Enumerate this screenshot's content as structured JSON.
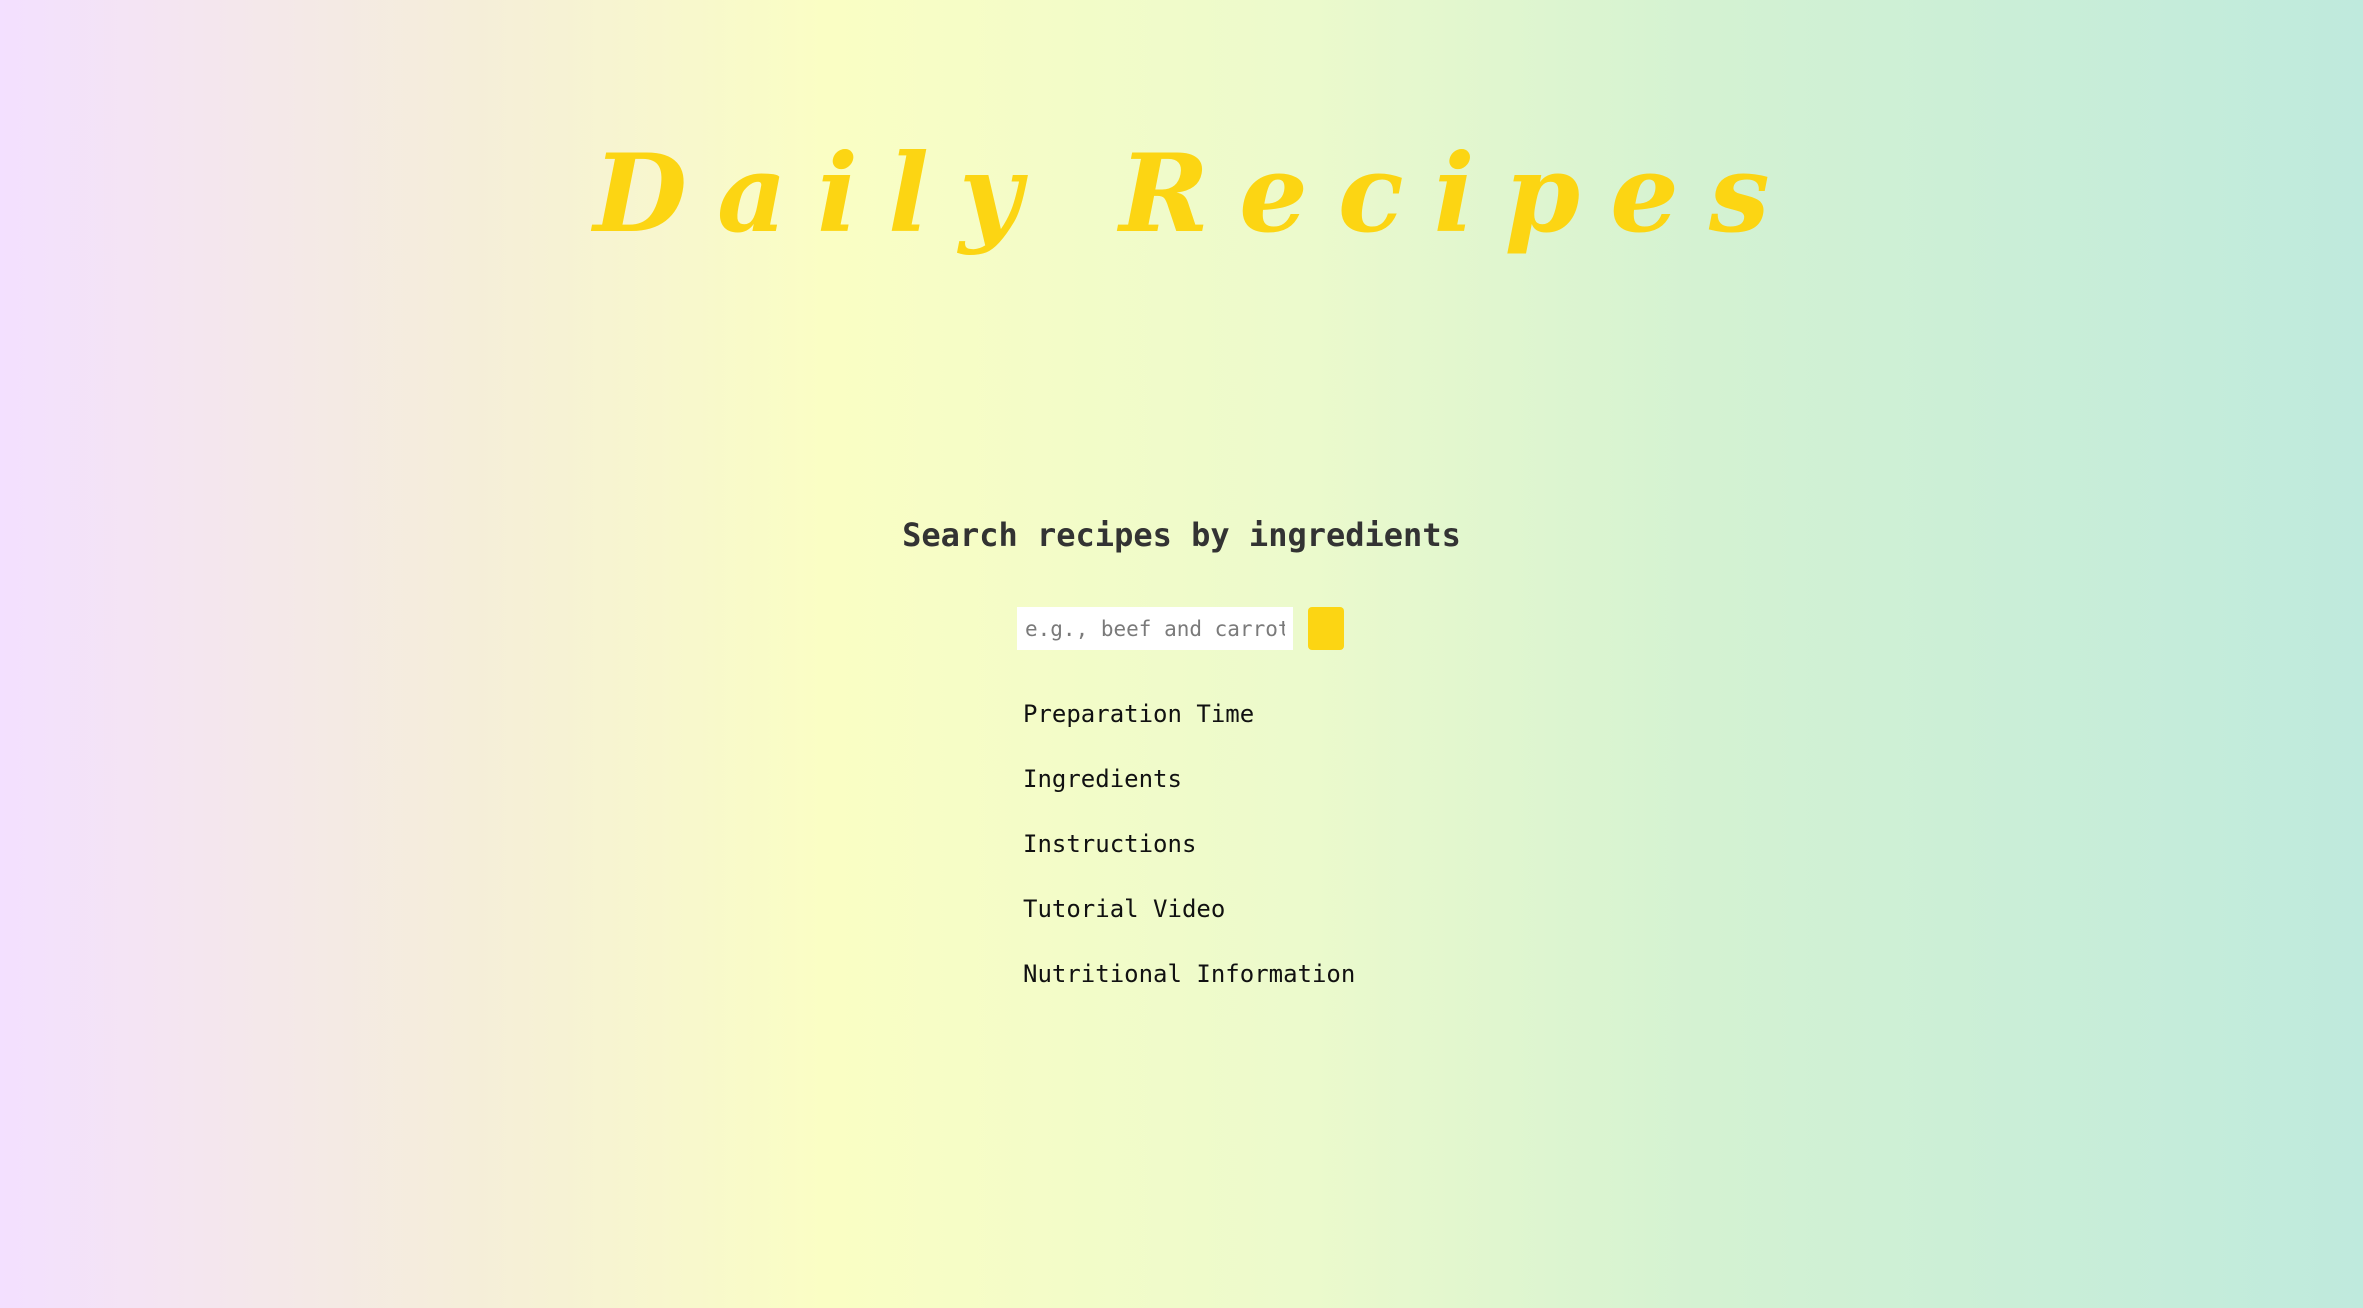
{
  "header": {
    "title": "Daily Recipes"
  },
  "search": {
    "heading": "Search recipes by ingredients",
    "placeholder": "e.g., beef and carrot",
    "value": "",
    "button_label": ""
  },
  "menu": {
    "items": [
      {
        "label": "Preparation Time"
      },
      {
        "label": "Ingredients"
      },
      {
        "label": "Instructions"
      },
      {
        "label": "Tutorial Video"
      },
      {
        "label": "Nutritional Information"
      }
    ]
  },
  "colors": {
    "accent": "#fcd513",
    "heading_text": "#333333",
    "menu_text": "#111111"
  }
}
